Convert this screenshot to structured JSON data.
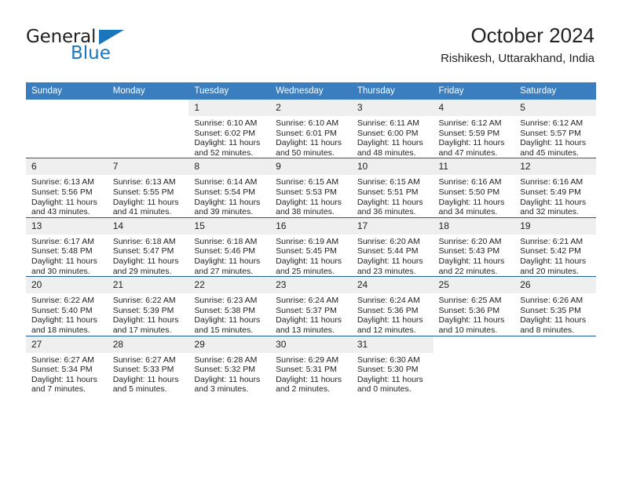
{
  "brand": {
    "word_one": "General",
    "word_two": "Blue",
    "triangle_icon": "triangle-icon",
    "color_dark": "#231f20",
    "color_blue": "#1b75bb"
  },
  "header": {
    "title": "October 2024",
    "subtitle": "Rishikesh, Uttarakhand, India"
  },
  "theme": {
    "header_bg": "#3a7ebf",
    "row_line": "#1f5c9e",
    "daynum_bg": "#efefef",
    "text": "#222222"
  },
  "weekdays": [
    "Sunday",
    "Monday",
    "Tuesday",
    "Wednesday",
    "Thursday",
    "Friday",
    "Saturday"
  ],
  "labels": {
    "sunrise": "Sunrise:",
    "sunset": "Sunset:",
    "daylight": "Daylight:"
  },
  "weeks": [
    [
      {
        "day": "",
        "sunrise": "",
        "sunset": "",
        "daylight1": "",
        "daylight2": ""
      },
      {
        "day": "",
        "sunrise": "",
        "sunset": "",
        "daylight1": "",
        "daylight2": ""
      },
      {
        "day": "1",
        "sunrise": "Sunrise: 6:10 AM",
        "sunset": "Sunset: 6:02 PM",
        "daylight1": "Daylight: 11 hours",
        "daylight2": "and 52 minutes."
      },
      {
        "day": "2",
        "sunrise": "Sunrise: 6:10 AM",
        "sunset": "Sunset: 6:01 PM",
        "daylight1": "Daylight: 11 hours",
        "daylight2": "and 50 minutes."
      },
      {
        "day": "3",
        "sunrise": "Sunrise: 6:11 AM",
        "sunset": "Sunset: 6:00 PM",
        "daylight1": "Daylight: 11 hours",
        "daylight2": "and 48 minutes."
      },
      {
        "day": "4",
        "sunrise": "Sunrise: 6:12 AM",
        "sunset": "Sunset: 5:59 PM",
        "daylight1": "Daylight: 11 hours",
        "daylight2": "and 47 minutes."
      },
      {
        "day": "5",
        "sunrise": "Sunrise: 6:12 AM",
        "sunset": "Sunset: 5:57 PM",
        "daylight1": "Daylight: 11 hours",
        "daylight2": "and 45 minutes."
      }
    ],
    [
      {
        "day": "6",
        "sunrise": "Sunrise: 6:13 AM",
        "sunset": "Sunset: 5:56 PM",
        "daylight1": "Daylight: 11 hours",
        "daylight2": "and 43 minutes."
      },
      {
        "day": "7",
        "sunrise": "Sunrise: 6:13 AM",
        "sunset": "Sunset: 5:55 PM",
        "daylight1": "Daylight: 11 hours",
        "daylight2": "and 41 minutes."
      },
      {
        "day": "8",
        "sunrise": "Sunrise: 6:14 AM",
        "sunset": "Sunset: 5:54 PM",
        "daylight1": "Daylight: 11 hours",
        "daylight2": "and 39 minutes."
      },
      {
        "day": "9",
        "sunrise": "Sunrise: 6:15 AM",
        "sunset": "Sunset: 5:53 PM",
        "daylight1": "Daylight: 11 hours",
        "daylight2": "and 38 minutes."
      },
      {
        "day": "10",
        "sunrise": "Sunrise: 6:15 AM",
        "sunset": "Sunset: 5:51 PM",
        "daylight1": "Daylight: 11 hours",
        "daylight2": "and 36 minutes."
      },
      {
        "day": "11",
        "sunrise": "Sunrise: 6:16 AM",
        "sunset": "Sunset: 5:50 PM",
        "daylight1": "Daylight: 11 hours",
        "daylight2": "and 34 minutes."
      },
      {
        "day": "12",
        "sunrise": "Sunrise: 6:16 AM",
        "sunset": "Sunset: 5:49 PM",
        "daylight1": "Daylight: 11 hours",
        "daylight2": "and 32 minutes."
      }
    ],
    [
      {
        "day": "13",
        "sunrise": "Sunrise: 6:17 AM",
        "sunset": "Sunset: 5:48 PM",
        "daylight1": "Daylight: 11 hours",
        "daylight2": "and 30 minutes."
      },
      {
        "day": "14",
        "sunrise": "Sunrise: 6:18 AM",
        "sunset": "Sunset: 5:47 PM",
        "daylight1": "Daylight: 11 hours",
        "daylight2": "and 29 minutes."
      },
      {
        "day": "15",
        "sunrise": "Sunrise: 6:18 AM",
        "sunset": "Sunset: 5:46 PM",
        "daylight1": "Daylight: 11 hours",
        "daylight2": "and 27 minutes."
      },
      {
        "day": "16",
        "sunrise": "Sunrise: 6:19 AM",
        "sunset": "Sunset: 5:45 PM",
        "daylight1": "Daylight: 11 hours",
        "daylight2": "and 25 minutes."
      },
      {
        "day": "17",
        "sunrise": "Sunrise: 6:20 AM",
        "sunset": "Sunset: 5:44 PM",
        "daylight1": "Daylight: 11 hours",
        "daylight2": "and 23 minutes."
      },
      {
        "day": "18",
        "sunrise": "Sunrise: 6:20 AM",
        "sunset": "Sunset: 5:43 PM",
        "daylight1": "Daylight: 11 hours",
        "daylight2": "and 22 minutes."
      },
      {
        "day": "19",
        "sunrise": "Sunrise: 6:21 AM",
        "sunset": "Sunset: 5:42 PM",
        "daylight1": "Daylight: 11 hours",
        "daylight2": "and 20 minutes."
      }
    ],
    [
      {
        "day": "20",
        "sunrise": "Sunrise: 6:22 AM",
        "sunset": "Sunset: 5:40 PM",
        "daylight1": "Daylight: 11 hours",
        "daylight2": "and 18 minutes."
      },
      {
        "day": "21",
        "sunrise": "Sunrise: 6:22 AM",
        "sunset": "Sunset: 5:39 PM",
        "daylight1": "Daylight: 11 hours",
        "daylight2": "and 17 minutes."
      },
      {
        "day": "22",
        "sunrise": "Sunrise: 6:23 AM",
        "sunset": "Sunset: 5:38 PM",
        "daylight1": "Daylight: 11 hours",
        "daylight2": "and 15 minutes."
      },
      {
        "day": "23",
        "sunrise": "Sunrise: 6:24 AM",
        "sunset": "Sunset: 5:37 PM",
        "daylight1": "Daylight: 11 hours",
        "daylight2": "and 13 minutes."
      },
      {
        "day": "24",
        "sunrise": "Sunrise: 6:24 AM",
        "sunset": "Sunset: 5:36 PM",
        "daylight1": "Daylight: 11 hours",
        "daylight2": "and 12 minutes."
      },
      {
        "day": "25",
        "sunrise": "Sunrise: 6:25 AM",
        "sunset": "Sunset: 5:36 PM",
        "daylight1": "Daylight: 11 hours",
        "daylight2": "and 10 minutes."
      },
      {
        "day": "26",
        "sunrise": "Sunrise: 6:26 AM",
        "sunset": "Sunset: 5:35 PM",
        "daylight1": "Daylight: 11 hours",
        "daylight2": "and 8 minutes."
      }
    ],
    [
      {
        "day": "27",
        "sunrise": "Sunrise: 6:27 AM",
        "sunset": "Sunset: 5:34 PM",
        "daylight1": "Daylight: 11 hours",
        "daylight2": "and 7 minutes."
      },
      {
        "day": "28",
        "sunrise": "Sunrise: 6:27 AM",
        "sunset": "Sunset: 5:33 PM",
        "daylight1": "Daylight: 11 hours",
        "daylight2": "and 5 minutes."
      },
      {
        "day": "29",
        "sunrise": "Sunrise: 6:28 AM",
        "sunset": "Sunset: 5:32 PM",
        "daylight1": "Daylight: 11 hours",
        "daylight2": "and 3 minutes."
      },
      {
        "day": "30",
        "sunrise": "Sunrise: 6:29 AM",
        "sunset": "Sunset: 5:31 PM",
        "daylight1": "Daylight: 11 hours",
        "daylight2": "and 2 minutes."
      },
      {
        "day": "31",
        "sunrise": "Sunrise: 6:30 AM",
        "sunset": "Sunset: 5:30 PM",
        "daylight1": "Daylight: 11 hours",
        "daylight2": "and 0 minutes."
      },
      {
        "day": "",
        "sunrise": "",
        "sunset": "",
        "daylight1": "",
        "daylight2": ""
      },
      {
        "day": "",
        "sunrise": "",
        "sunset": "",
        "daylight1": "",
        "daylight2": ""
      }
    ]
  ]
}
